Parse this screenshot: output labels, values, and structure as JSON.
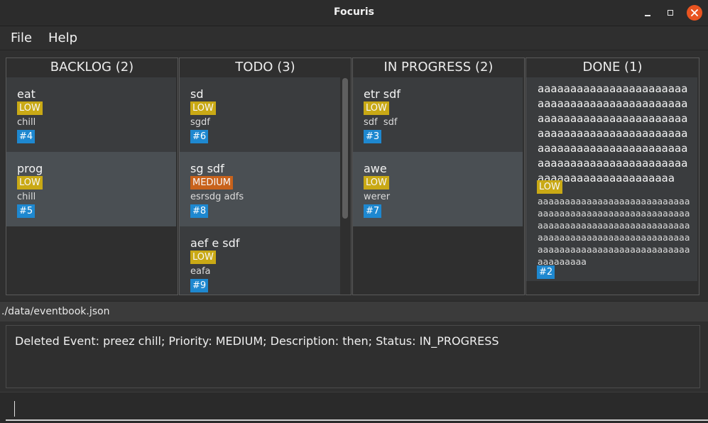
{
  "window": {
    "title": "Focuris"
  },
  "menu": {
    "file": "File",
    "help": "Help"
  },
  "columns": [
    {
      "header": "BACKLOG (2)",
      "cards": [
        {
          "name": "eat",
          "priority": "LOW",
          "description": "chill",
          "id": "#4"
        },
        {
          "name": "prog",
          "priority": "LOW",
          "description": "chill",
          "id": "#5"
        }
      ]
    },
    {
      "header": "TODO (3)",
      "cards": [
        {
          "name": "sd",
          "priority": "LOW",
          "description": "sgdf",
          "id": "#6"
        },
        {
          "name": "sg sdf",
          "priority": "MEDIUM",
          "description": "esrsdg adfs",
          "id": "#8"
        },
        {
          "name": "aef e sdf",
          "priority": "LOW",
          "description": "eafa",
          "id": "#9"
        }
      ]
    },
    {
      "header": "IN PROGRESS (2)",
      "cards": [
        {
          "name": "etr sdf",
          "priority": "LOW",
          "description": "sdf  sdf",
          "id": "#3"
        },
        {
          "name": "awe",
          "priority": "LOW",
          "description": "werer",
          "id": "#7"
        }
      ]
    },
    {
      "header": "DONE (1)",
      "cards": [
        {
          "name": "aaaaaaaaaaaaaaaaaaaaaaaaaaaaaaaaaaaaaaaaaaaaaaaaaaaaaaaaaaaaaaaaaaaaaaaaaaaaaaaaaaaaaaaaaaaaaaaaaaaaaaaaaaaaaaaaaaaaaaaaaaaaaaaaaaaaaaaaaaaaaaaaaaaaaaaaaaaaaaa",
          "priority": "LOW",
          "description": "aaaaaaaaaaaaaaaaaaaaaaaaaaaaaaaaaaaaaaaaaaaaaaaaaaaaaaaaaaaaaaaaaaaaaaaaaaaaaaaaaaaaaaaaaaaaaaaaaaaaaaaaaaaaaaaaaaaaaaaaaaaaaaaaaaaaaaaaaaaaaaaaaaaaa",
          "id": "#2"
        }
      ]
    }
  ],
  "status_bar": {
    "file_path": "./data/eventbook.json"
  },
  "result_display": {
    "text": "Deleted Event: preez chill; Priority: MEDIUM; Description: then; Status: IN_PROGRESS"
  },
  "command_box": {
    "value": ""
  },
  "colors": {
    "priority_low": "#c9a915",
    "priority_medium": "#c8621b",
    "id_badge": "#1e88d0",
    "close_button": "#e95420"
  },
  "icons": {
    "minimize": "minimize-icon",
    "maximize": "maximize-icon",
    "close": "close-icon"
  }
}
